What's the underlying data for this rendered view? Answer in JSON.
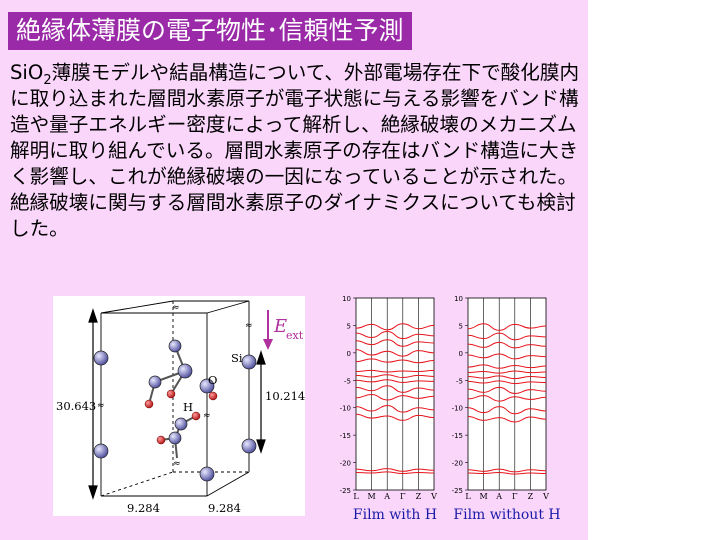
{
  "title": "絶縁体薄膜の電子物性･信頼性予測",
  "body": {
    "before_sub": "SiO",
    "sub": "2",
    "after_sub": "薄膜モデルや結晶構造について、外部電場存在下で酸化膜内に取り込まれた層間水素原子が電子状態に与える影響をバンド構造や量子エネルギー密度によって解析し、絶縁破壊のメカニズム解明に取り組んでいる。層間水素原子の存在はバンド構造に大きく影響し、これが絶縁破壊の一因になっていることが示された。絶縁破壊に関与する層間水素原子のダイナミクスについても検討した。"
  },
  "structure": {
    "height_label": "30.643",
    "inner_label": "10.214",
    "width_label_1": "9.284",
    "width_label_2": "9.284",
    "atom_si": "Si",
    "atom_o": "O",
    "atom_h": "H"
  },
  "field": {
    "label_main": "E",
    "label_sub": "ext",
    "color": "#b0309e"
  },
  "colors": {
    "panel_bg": "#fbd6fb",
    "title_bg": "#9a2aa8",
    "band_line": "#e8141c",
    "caption": "#1a1aa8"
  },
  "band_axes": {
    "y_ticks": [
      "10",
      "5",
      "0",
      "-5",
      "-10",
      "-15",
      "-20",
      "-25"
    ],
    "k_labels": [
      "L",
      "M",
      "A",
      "Γ",
      "Z",
      "V"
    ]
  },
  "chart_data": [
    {
      "type": "line",
      "title": "Film with H",
      "ylim": [
        -25,
        10
      ],
      "x": [
        "L",
        "M",
        "A",
        "Γ",
        "Z",
        "V"
      ],
      "series": [
        {
          "values": [
            4.5,
            5.2,
            4.2,
            5.3,
            4.4,
            5.0
          ]
        },
        {
          "values": [
            3.6,
            2.8,
            3.9,
            2.6,
            3.4,
            3.1
          ]
        },
        {
          "values": [
            2.2,
            1.5,
            2.4,
            1.2,
            2.0,
            1.8
          ]
        },
        {
          "values": [
            0.6,
            -0.4,
            0.3,
            -0.6,
            0.4,
            0.0
          ]
        },
        {
          "values": [
            -1.6,
            -1.1,
            -1.7,
            -1.3,
            -1.8,
            -1.4
          ]
        },
        {
          "values": [
            -3.4,
            -3.2,
            -3.5,
            -3.3,
            -3.4,
            -3.2
          ]
        },
        {
          "values": [
            -4.1,
            -4.4,
            -4.0,
            -4.5,
            -4.1,
            -4.3
          ]
        },
        {
          "values": [
            -5.0,
            -5.3,
            -4.9,
            -5.4,
            -5.1,
            -5.2
          ]
        },
        {
          "values": [
            -6.3,
            -6.9,
            -6.0,
            -7.2,
            -6.4,
            -6.8
          ]
        },
        {
          "values": [
            -8.2,
            -7.6,
            -8.6,
            -7.8,
            -8.3,
            -7.9
          ]
        },
        {
          "values": [
            -9.8,
            -10.6,
            -9.6,
            -10.8,
            -10.0,
            -10.4
          ]
        },
        {
          "values": [
            -11.2,
            -11.9,
            -11.5,
            -12.3,
            -11.4,
            -11.8
          ]
        },
        {
          "values": [
            -21.2,
            -21.5,
            -21.1,
            -21.6,
            -21.2,
            -21.4
          ]
        },
        {
          "values": [
            -21.8,
            -21.9,
            -21.7,
            -22.0,
            -21.8,
            -21.9
          ]
        }
      ]
    },
    {
      "type": "line",
      "title": "Film without H",
      "ylim": [
        -25,
        10
      ],
      "x": [
        "L",
        "M",
        "A",
        "Γ",
        "Z",
        "V"
      ],
      "series": [
        {
          "values": [
            4.4,
            5.3,
            4.1,
            5.2,
            4.5,
            4.9
          ]
        },
        {
          "values": [
            3.2,
            2.6,
            3.6,
            2.4,
            3.1,
            2.9
          ]
        },
        {
          "values": [
            1.6,
            1.0,
            1.9,
            0.9,
            1.5,
            1.2
          ]
        },
        {
          "values": [
            -0.4,
            -0.9,
            -0.2,
            -1.1,
            -0.5,
            -0.7
          ]
        },
        {
          "values": [
            -2.6,
            -2.2,
            -2.8,
            -2.3,
            -2.7,
            -2.4
          ]
        },
        {
          "values": [
            -3.6,
            -3.4,
            -3.7,
            -3.3,
            -3.6,
            -3.5
          ]
        },
        {
          "values": [
            -4.3,
            -4.6,
            -4.2,
            -4.7,
            -4.3,
            -4.5
          ]
        },
        {
          "values": [
            -5.2,
            -5.5,
            -5.1,
            -5.6,
            -5.3,
            -5.4
          ]
        },
        {
          "values": [
            -6.6,
            -7.2,
            -6.3,
            -7.4,
            -6.7,
            -7.0
          ]
        },
        {
          "values": [
            -8.4,
            -7.8,
            -8.8,
            -8.0,
            -8.5,
            -8.1
          ]
        },
        {
          "values": [
            -10.0,
            -10.9,
            -9.8,
            -11.1,
            -10.2,
            -10.6
          ]
        },
        {
          "values": [
            -11.6,
            -12.3,
            -11.8,
            -12.6,
            -11.7,
            -12.1
          ]
        },
        {
          "values": [
            -21.3,
            -21.6,
            -21.2,
            -21.7,
            -21.3,
            -21.5
          ]
        },
        {
          "values": [
            -21.9,
            -22.0,
            -21.8,
            -22.1,
            -21.9,
            -22.0
          ]
        }
      ]
    }
  ]
}
